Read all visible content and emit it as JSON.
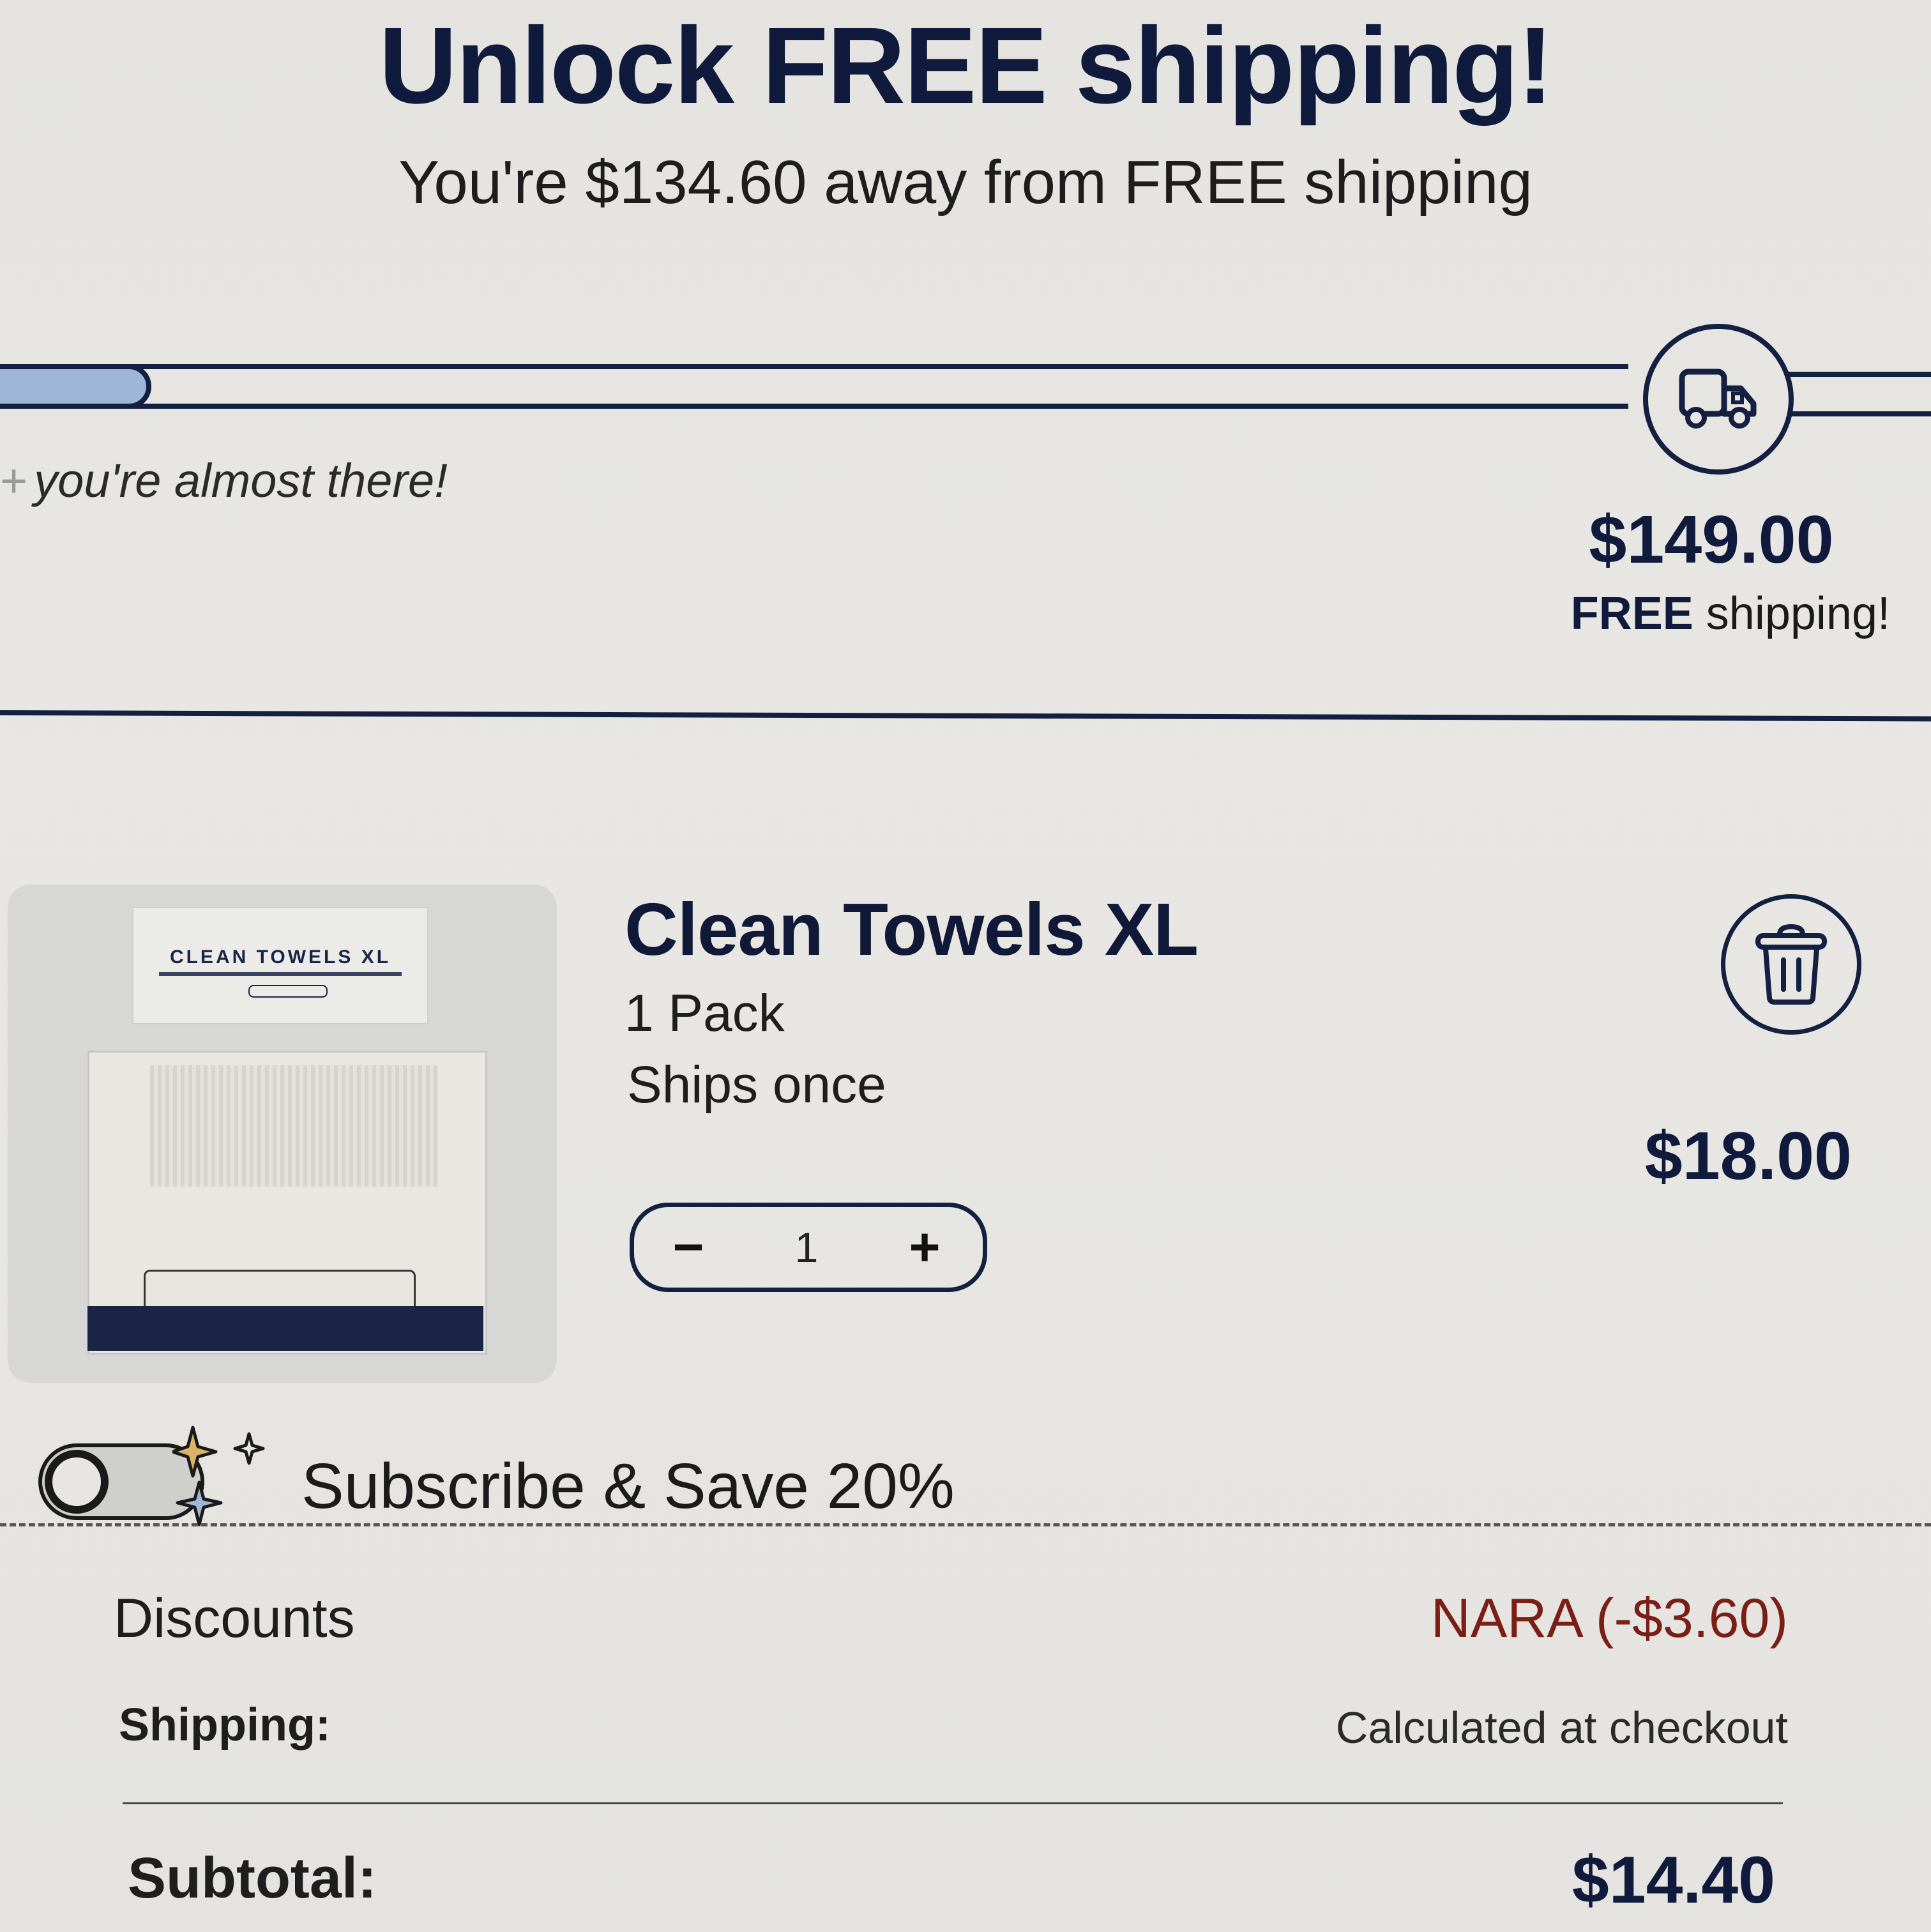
{
  "header": {
    "headline": "Unlock FREE shipping!",
    "subhead": "You're $134.60 away from FREE shipping"
  },
  "progress": {
    "fraction": 0.0966,
    "message": "you're almost there!",
    "goal_amount": "$149.00",
    "goal_free": "FREE",
    "goal_rest": "shipping!",
    "icon": "truck-icon"
  },
  "cart_item": {
    "image_title": "CLEAN TOWELS XL",
    "name": "Clean Towels XL",
    "variant": "1 Pack",
    "ships": "Ships once",
    "quantity": "1",
    "minus": "−",
    "plus": "+",
    "price": "$18.00",
    "delete_icon": "trash-icon"
  },
  "subscribe": {
    "label": "Subscribe & Save 20%",
    "enabled": false
  },
  "summary": {
    "discounts_label": "Discounts",
    "discounts_value": "NARA (-$3.60)",
    "shipping_label": "Shipping:",
    "shipping_value": "Calculated at checkout",
    "subtotal_label": "Subtotal:",
    "subtotal_value": "$14.40"
  },
  "colors": {
    "navy": "#0f1a3c",
    "progress_fill": "#9fb7d6",
    "discount_red": "#7a1e16",
    "background": "#e6e5e1"
  }
}
